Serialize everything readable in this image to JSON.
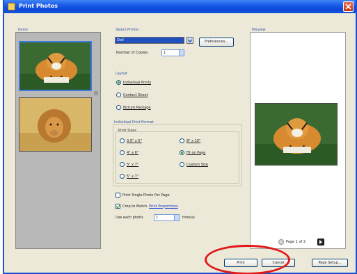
{
  "window": {
    "title": "Print Photos"
  },
  "items": {
    "label": "Items"
  },
  "select_printer": {
    "label": "Select Printer",
    "value": "Dell",
    "preferences_label": "Preferences...",
    "copies_label": "Number of Copies:",
    "copies_value": "1"
  },
  "layout": {
    "label": "Layout",
    "options": [
      "Individual Prints",
      "Contact Sheet",
      "Picture Package"
    ],
    "selected": 0
  },
  "print_format": {
    "label": "Individual Print Format",
    "sizes_label": "Print Sizes",
    "sizes": [
      "3.5\" x 5\"",
      "4\" x 6\"",
      "5\" x 7\"",
      "8\" x 10\"",
      "Fit on Page",
      "Custom Size",
      "5\" x 7\""
    ]
  },
  "options": {
    "one_photo": "Print Single Photo Per Page",
    "crop_label": "Crop to Match",
    "crop_link": "Print Proportions",
    "use_each_label": "Use each photo:",
    "use_each_value": "1",
    "times": "time(s)"
  },
  "preview": {
    "label": "Preview",
    "page_label": "Page 1 of 2"
  },
  "footer": {
    "print_label": "Print",
    "cancel_label": "Cancel",
    "page_setup_label": "Page Setup..."
  },
  "colors": {
    "title_bar": "#0a48d8",
    "highlight": "#e01818"
  }
}
